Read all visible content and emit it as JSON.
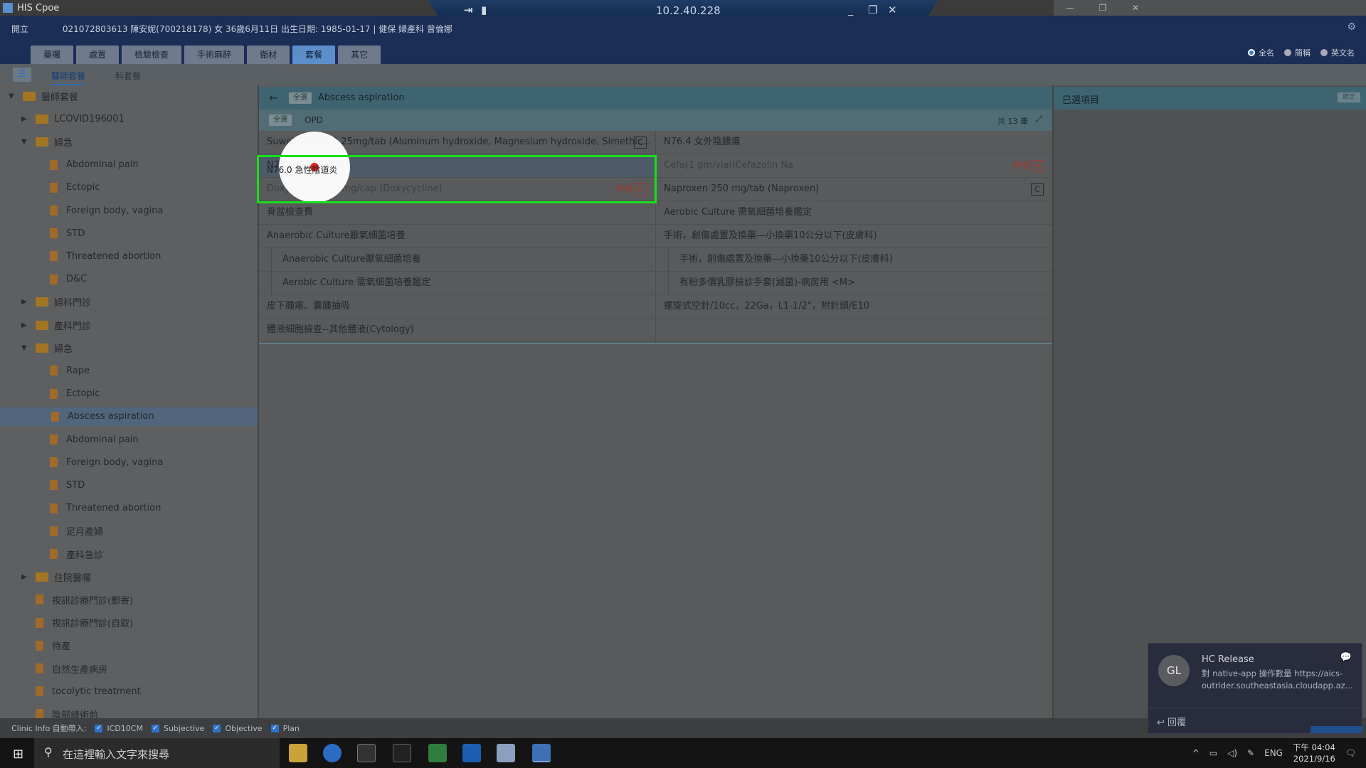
{
  "window": {
    "title": "HIS Cpoe",
    "remote_ip": "10.2.40.228"
  },
  "patient": {
    "mode": "開立",
    "info": "021072803613 陳安妮(700218178) 女 36歲6月11日 出生日期: 1985-01-17 | 健保 婦產科 曾倫娜"
  },
  "tabs": [
    "藥囑",
    "處置",
    "檢驗檢查",
    "手術麻醉",
    "衛材",
    "套餐",
    "其它"
  ],
  "name_display": {
    "options": [
      "全名",
      "簡稱",
      "英文名"
    ],
    "selected": "全名"
  },
  "subtabs": [
    "醫師套餐",
    "科套餐"
  ],
  "tree": [
    {
      "label": "醫師套餐",
      "type": "folder",
      "level": 0,
      "expanded": true
    },
    {
      "label": "LCOVID196001",
      "type": "folder",
      "level": 1,
      "expanded": false
    },
    {
      "label": "婦急",
      "type": "folder",
      "level": 1,
      "expanded": true
    },
    {
      "label": "Abdominal pain",
      "type": "doc",
      "level": 2
    },
    {
      "label": "Ectopic",
      "type": "doc",
      "level": 2
    },
    {
      "label": "Foreign body, vagina",
      "type": "doc",
      "level": 2
    },
    {
      "label": "STD",
      "type": "doc",
      "level": 2
    },
    {
      "label": "Threatened abortion",
      "type": "doc",
      "level": 2
    },
    {
      "label": "D&C",
      "type": "doc",
      "level": 2
    },
    {
      "label": "婦科門診",
      "type": "folder",
      "level": 1,
      "expanded": false
    },
    {
      "label": "產科門診",
      "type": "folder",
      "level": 1,
      "expanded": false
    },
    {
      "label": "婦急",
      "type": "folder",
      "level": 1,
      "expanded": true
    },
    {
      "label": "Rape",
      "type": "doc",
      "level": 2
    },
    {
      "label": "Ectopic",
      "type": "doc",
      "level": 2
    },
    {
      "label": "Abscess aspiration",
      "type": "doc",
      "level": 2,
      "selected": true
    },
    {
      "label": "Abdominal pain",
      "type": "doc",
      "level": 2
    },
    {
      "label": "Foreign body, vagina",
      "type": "doc",
      "level": 2
    },
    {
      "label": "STD",
      "type": "doc",
      "level": 2
    },
    {
      "label": "Threatened abortion",
      "type": "doc",
      "level": 2
    },
    {
      "label": "足月產婦",
      "type": "doc",
      "level": 2
    },
    {
      "label": "產科急診",
      "type": "doc",
      "level": 2
    },
    {
      "label": "住院醫囑",
      "type": "folder",
      "level": 1,
      "expanded": false
    },
    {
      "label": "視訊診療門診(郵寄)",
      "type": "doc",
      "level": 1
    },
    {
      "label": "視訊診療門診(自取)",
      "type": "doc",
      "level": 1
    },
    {
      "label": "待產",
      "type": "doc",
      "level": 1
    },
    {
      "label": "自然生產病房",
      "type": "doc",
      "level": 1
    },
    {
      "label": "tocolytic treatment",
      "type": "doc",
      "level": 1
    },
    {
      "label": "陰部縫術前",
      "type": "doc",
      "level": 1
    }
  ],
  "main": {
    "header_filter": "全選",
    "title": "Abscess aspiration",
    "sub_filter": "全選",
    "setting": "OPD",
    "count": "共 13 筆",
    "left_col": [
      {
        "text": "Suwell 200,200,25mg/tab (Aluminum hydroxide, Magnesium hydroxide, Simethic...",
        "badge": "C"
      },
      {
        "text": "N76.0 急性陰道炎",
        "highlight": true
      },
      {
        "text": "Doxymycin 100 mg/cap (Doxycycline)",
        "status": "停用",
        "badge": "D",
        "disabled": true
      },
      {
        "text": "骨盆檢查費"
      },
      {
        "text": "Anaerobic Culture厭氧細菌培養"
      },
      {
        "text": "Anaerobic Culture厭氧細菌培養",
        "indent": true
      },
      {
        "text": "Aerobic Culture 需氧細菌培養鑑定",
        "indent": true
      },
      {
        "text": "皮下腫瘍、囊腫抽吸"
      },
      {
        "text": "體液細胞檢查--其他體液(Cytology)"
      }
    ],
    "right_col": [
      {
        "text": "N76.4 女外陰膿瘍"
      },
      {
        "text": "Cefa(1 gm/vial)Cefazolin Na",
        "status": "停用",
        "badge": "B",
        "disabled": true
      },
      {
        "text": "Naproxen 250 mg/tab (Naproxen)",
        "badge": "C"
      },
      {
        "text": "Aerobic Culture 需氧細菌培養鑑定"
      },
      {
        "text": "手術，創傷處置及換藥—小換藥10公分以下(皮膚科)"
      },
      {
        "text": "手術，創傷處置及換藥—小換藥10公分以下(皮膚科)",
        "indent": true
      },
      {
        "text": "有粉多價乳膠檢診手套(滅菌)-病房用 <M>",
        "indent": true
      },
      {
        "text": "螺旋式空針/10cc，22Ga，L1-1/2\"，附針頭/E10"
      },
      {
        "text": ""
      }
    ]
  },
  "selected_panel": {
    "title": "已選項目",
    "button": "確定"
  },
  "footer": {
    "label": "Clinic Info 自動帶入:",
    "checks": [
      "ICD10CM",
      "Subjective",
      "Objective",
      "Plan"
    ]
  },
  "toast": {
    "avatar": "GL",
    "title": "HC Release",
    "body": "對 native-app 操作數量 https://aics-outrider.southeastasia.cloudapp.az...",
    "reply": "回覆"
  },
  "taskbar": {
    "search_placeholder": "在這裡輸入文字來搜尋",
    "lang": "ENG",
    "time": "下午 04:04",
    "date": "2021/9/16"
  },
  "colors": {
    "header": "#1b2f56",
    "panel_header": "#3f6471",
    "highlight_border": "#18e018",
    "stop": "#9e3a2c"
  }
}
